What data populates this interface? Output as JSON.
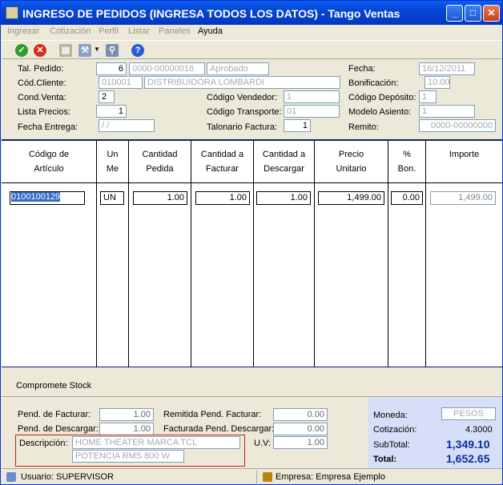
{
  "window": {
    "title": "INGRESO DE PEDIDOS (INGRESA TODOS LOS DATOS) - Tango Ventas"
  },
  "menu": [
    "Ingresar",
    "Cotización",
    "Perfil",
    "Listar",
    "Paneles",
    "Ayuda"
  ],
  "header": {
    "tal_pedido_label": "Tal. Pedido:",
    "tal_pedido": "6",
    "numero": "0000-00000016",
    "estado": "Aprobado",
    "fecha_label": "Fecha:",
    "fecha": "16/12/2011",
    "cod_cliente_label": "Cód.Cliente:",
    "cod_cliente": "010001",
    "cliente_nombre": "DISTRIBUIDORA LOMBARDI",
    "bonificacion_label": "Bonificación:",
    "bonificacion": "10.00",
    "cond_venta_label": "Cond.Venta:",
    "cond_venta": "2",
    "cod_vendedor_label": "Código Vendedor:",
    "cod_vendedor": "1",
    "cod_deposito_label": "Código Depósito:",
    "cod_deposito": "1",
    "lista_precios_label": "Lista Precios:",
    "lista_precios": "1",
    "cod_transporte_label": "Código Transporte:",
    "cod_transporte": "01",
    "modelo_asiento_label": "Modelo Asiento:",
    "modelo_asiento": "1",
    "fecha_entrega_label": "Fecha Entrega:",
    "fecha_entrega": " / /",
    "talonario_label": "Talonario Factura:",
    "talonario": "1",
    "remito_label": "Remito:",
    "remito": "0000-00000000"
  },
  "grid": {
    "headers": [
      {
        "l1": "Código de",
        "l2": "Artículo"
      },
      {
        "l1": "Un",
        "l2": "Me"
      },
      {
        "l1": "Cantidad",
        "l2": "Pedida"
      },
      {
        "l1": "Cantidad a",
        "l2": "Facturar"
      },
      {
        "l1": "Cantidad a",
        "l2": "Descargar"
      },
      {
        "l1": "Precio",
        "l2": "Unitario"
      },
      {
        "l1": "%",
        "l2": "Bon."
      },
      {
        "l1": "Importe",
        "l2": ""
      }
    ],
    "row": {
      "codigo": "0100100129",
      "um": "UN",
      "pedida": "1.00",
      "facturar": "1.00",
      "descargar": "1.00",
      "precio": "1,499.00",
      "bon": "0.00",
      "importe": "1,499.00"
    }
  },
  "comprometer_label": "Compromete Stock",
  "bottom": {
    "pend_facturar_label": "Pend. de Facturar:",
    "pend_facturar": "1.00",
    "pend_descargar_label": "Pend. de Descargar:",
    "pend_descargar": "1.00",
    "remitida_label": "Remitida Pend. Facturar:",
    "remitida": "0.00",
    "facturada_label": "Facturada Pend. Descargar:",
    "facturada": "0.00",
    "descripcion_label": "Descripción:",
    "descripcion1": "HOME THEATER MARCA TCL",
    "descripcion2": "POTENCIA  RMS 800 W",
    "uv_label": "U.V:",
    "uv": "1.00"
  },
  "totals": {
    "moneda_label": "Moneda:",
    "moneda": "PESOS",
    "cotizacion_label": "Cotización:",
    "cotizacion": "4.3000",
    "subtotal_label": "SubTotal:",
    "subtotal": "1,349.10",
    "total_label": "Total:",
    "total": "1,652.65"
  },
  "status": {
    "usuario": "Usuario: SUPERVISOR",
    "empresa": "Empresa: Empresa Ejemplo"
  }
}
